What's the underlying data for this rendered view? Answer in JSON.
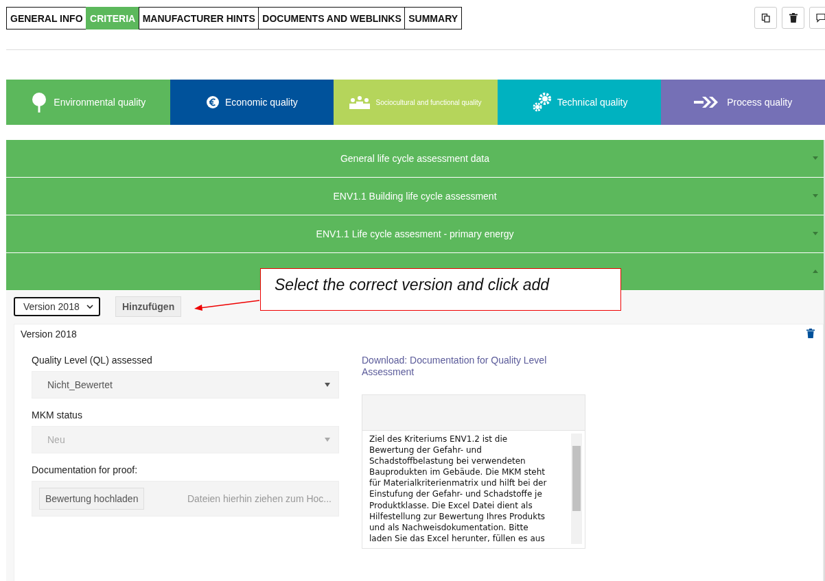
{
  "tabs": [
    {
      "label": "GENERAL INFO",
      "selected": false
    },
    {
      "label": "CRITERIA",
      "selected": true
    },
    {
      "label": "MANUFACTURER HINTS",
      "selected": false
    },
    {
      "label": "DOCUMENTS AND WEBLINKS",
      "selected": false
    },
    {
      "label": "SUMMARY",
      "selected": false
    }
  ],
  "categories": [
    {
      "label": "Environmental quality",
      "kind": "tree",
      "color": "#5cb85c"
    },
    {
      "label": "Economic quality",
      "kind": "euro",
      "color": "#00529b"
    },
    {
      "label": "Sociocultural and functional quality",
      "kind": "people",
      "color": "#b5d55b"
    },
    {
      "label": "Technical quality",
      "kind": "gears",
      "color": "#00b2c0"
    },
    {
      "label": "Process quality",
      "kind": "arrows",
      "color": "#7570b6"
    }
  ],
  "accordion": [
    {
      "title": "General life cycle assessment data",
      "expanded": false
    },
    {
      "title": "ENV1.1 Building life cycle assessment",
      "expanded": false
    },
    {
      "title": "ENV1.1 Life cycle assesment - primary energy",
      "expanded": false
    },
    {
      "expanded": true
    }
  ],
  "version_select": {
    "value": "Version 2018"
  },
  "add_button": "Hinzufügen",
  "callout": "Select the correct version and click add",
  "version_panel": {
    "title": "Version 2018",
    "quality_level": {
      "label": "Quality Level (QL) assessed",
      "value": "Nicht_Bewertet",
      "disabled": false
    },
    "mkm_status": {
      "label": "MKM status",
      "value": "Neu",
      "disabled": true
    },
    "documentation": {
      "label": "Documentation for proof:",
      "button": "Bewertung hochladen",
      "placeholder": "Dateien hierhin ziehen zum Hoc..."
    },
    "download_link": "Download: Documentation for Quality Level Assessment",
    "description": "Ziel des Kriteriums ENV1.2 ist die Bewertung der Gefahr- und Schadstoffbelastung bei verwendeten Bauprodukten im Gebäude. Die MKM steht für Materialkriterienmatrix und hilft bei der Einstufung der Gefahr- und Schadstoffe je Produktklasse. Die Excel Datei dient als Hilfestellung zur Bewertung Ihres Produkts und als Nachweisdokumentation. Bitte laden Sie das Excel herunter, füllen es aus"
  }
}
